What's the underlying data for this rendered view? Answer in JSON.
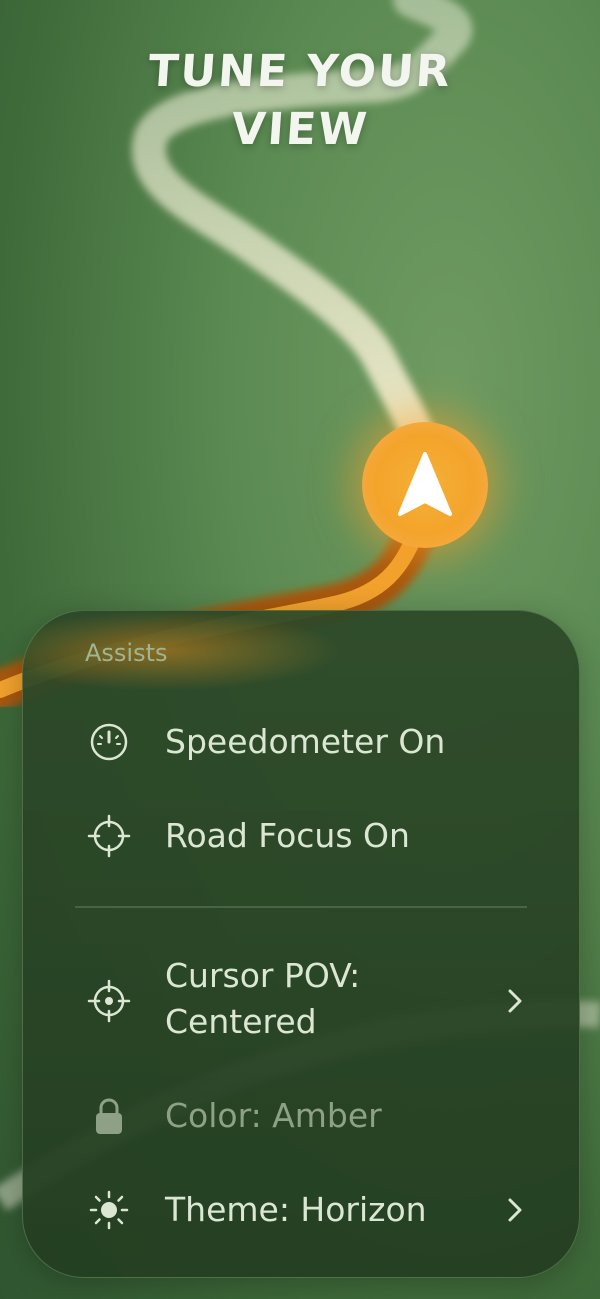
{
  "headline": {
    "line1": "TUNE YOUR",
    "line2": "VIEW"
  },
  "map": {
    "puck_icon": "navigation-arrow-icon",
    "route_color": "#f2a22e",
    "road_color": "#efe9cf"
  },
  "panel": {
    "section_title": "Assists",
    "items": [
      {
        "icon": "speedometer-icon",
        "label": "Speedometer On"
      },
      {
        "icon": "crosshair-icon",
        "label": "Road Focus On"
      },
      {
        "icon": "crosshair-dot-icon",
        "label_line1": "Cursor POV:",
        "label_line2": "Centered",
        "chevron": true
      },
      {
        "icon": "lock-icon",
        "label": "Color: Amber",
        "disabled": true
      },
      {
        "icon": "sun-icon",
        "label": "Theme: Horizon",
        "chevron": true
      }
    ]
  }
}
